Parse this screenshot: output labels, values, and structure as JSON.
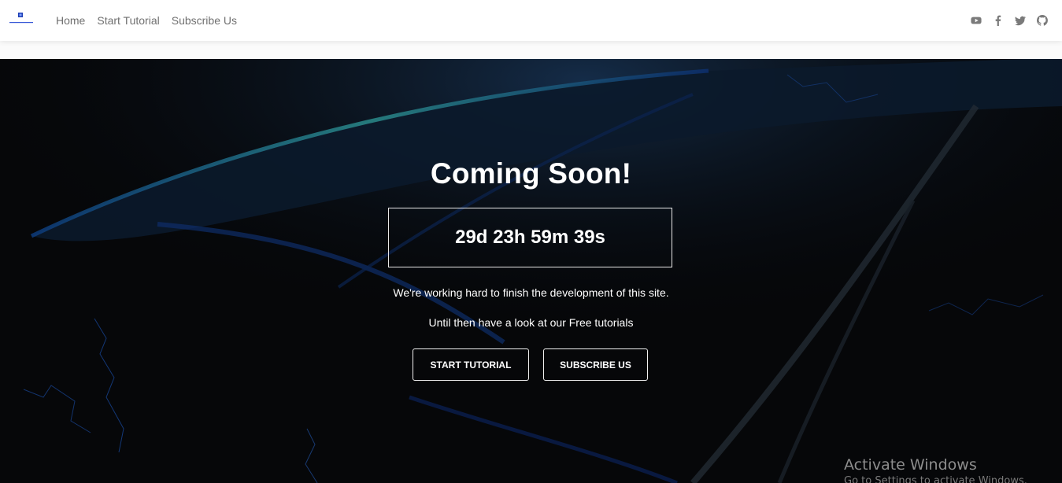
{
  "nav": {
    "logo_icon": "brand-logo",
    "links": [
      "Home",
      "Start Tutorial",
      "Subscribe Us"
    ],
    "socials": [
      "youtube-icon",
      "facebook-icon",
      "twitter-icon",
      "github-icon"
    ]
  },
  "hero": {
    "title": "Coming Soon!",
    "countdown": "29d 23h 59m 39s",
    "message_line1": "We're working hard to finish the development of this site.",
    "message_line2": "Until then have a look at our Free tutorials",
    "buttons": {
      "tutorial": "Start Tutorial",
      "subscribe": "Subscribe Us"
    }
  },
  "watermark": {
    "title": "Activate Windows",
    "subtitle": "Go to Settings to activate Windows."
  },
  "colors": {
    "background": "#050608",
    "text": "#ffffff",
    "nav_link": "#707070",
    "accent": "#1f4fd6"
  }
}
